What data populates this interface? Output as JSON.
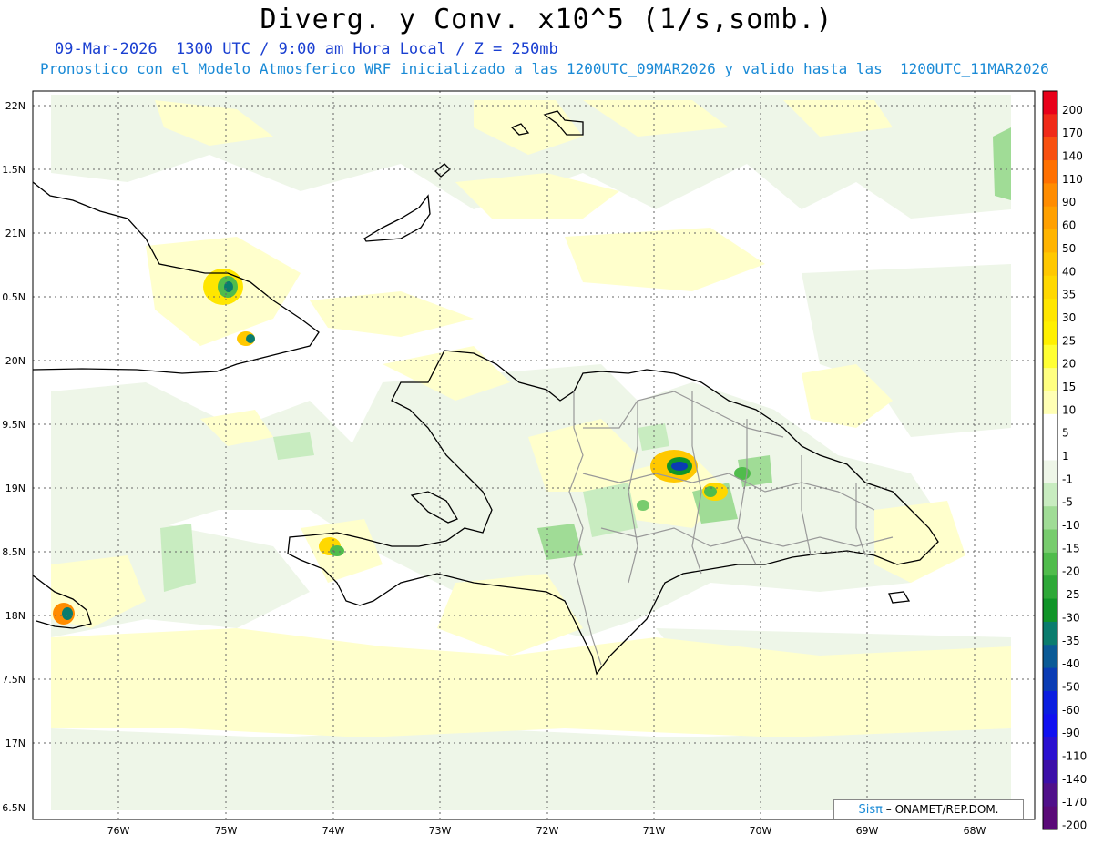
{
  "title": "Diverg. y Conv. x10^5 (1/s,somb.)",
  "subtitle_1": "09-Mar-2026  1300 UTC / 9:00 am Hora Local / Z = 250mb",
  "subtitle_2": "Pronostico con el Modelo Atmosferico WRF inicializado a las 1200UTC_09MAR2026 y valido hasta las  1200UTC_11MAR2026",
  "lat_labels": [
    "22N",
    "1.5N",
    "21N",
    "0.5N",
    "20N",
    "9.5N",
    "19N",
    "8.5N",
    "18N",
    "7.5N",
    "17N",
    "6.5N"
  ],
  "lon_labels": [
    "76W",
    "75W",
    "74W",
    "73W",
    "72W",
    "71W",
    "70W",
    "69W",
    "68W"
  ],
  "colorbar": {
    "labels": [
      "200",
      "170",
      "140",
      "110",
      "90",
      "60",
      "50",
      "40",
      "35",
      "30",
      "25",
      "20",
      "15",
      "10",
      "5",
      "1",
      "-1",
      "-5",
      "-10",
      "-15",
      "-20",
      "-25",
      "-30",
      "-35",
      "-40",
      "-50",
      "-60",
      "-90",
      "-110",
      "-140",
      "-170",
      "-200"
    ],
    "colors": [
      "#e8001a",
      "#f02a18",
      "#f85010",
      "#ff7000",
      "#ff8c00",
      "#ffa000",
      "#ffb400",
      "#ffc800",
      "#ffd800",
      "#ffe600",
      "#fff000",
      "#ffff33",
      "#ffff80",
      "#ffffb4",
      "#ffffff",
      "#ffffff",
      "#eef6e8",
      "#c8ecc0",
      "#a0dc96",
      "#78cc6e",
      "#50bc4c",
      "#2ea838",
      "#109428",
      "#0a7c6e",
      "#0a5a96",
      "#0a3cb4",
      "#0a1ee0",
      "#1010f0",
      "#2a10d0",
      "#3c0fa8",
      "#50108a",
      "#5a0a78"
    ]
  },
  "credit": {
    "logo": "Sisπ",
    "text": " – ONAMET/REP.DOM."
  }
}
